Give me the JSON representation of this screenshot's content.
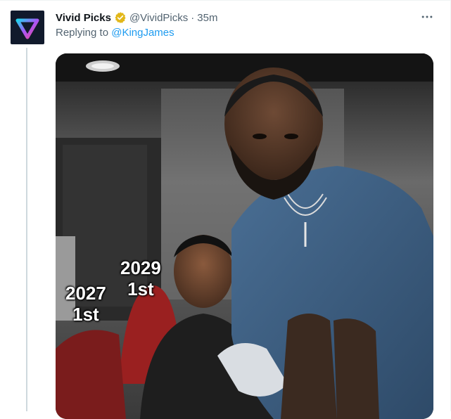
{
  "tweet": {
    "display_name": "Vivid Picks",
    "handle": "@VividPicks",
    "separator": "·",
    "time": "35m",
    "reply_prefix": "Replying to ",
    "reply_to": "@KingJames",
    "verified_badge_icon": "gold-verified-badge-icon",
    "more_icon": "more-horizontal-icon",
    "avatar_icon": "vivid-picks-logo-icon"
  },
  "media": {
    "overlay_texts": [
      {
        "year": "2029",
        "label": "1st"
      },
      {
        "year": "2027",
        "label": "1st"
      }
    ]
  },
  "colors": {
    "link": "#1d9bf0",
    "secondary_text": "#536471",
    "primary_text": "#0f1419",
    "badge_gold": "#e2b719",
    "avatar_bg": "#111a2c"
  }
}
